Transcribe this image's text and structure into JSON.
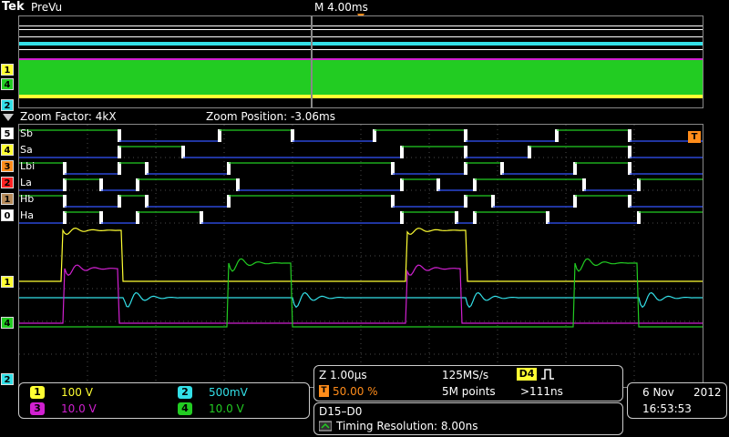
{
  "header": {
    "brand": "Tek",
    "mode": "PreVu",
    "timebase": "M 4.00ms",
    "trigger_marker": "T"
  },
  "zoom": {
    "factor": "Zoom Factor: 4kX",
    "position": "Zoom Position: -3.06ms"
  },
  "digital_channels": [
    {
      "num": "5",
      "label": "Sb",
      "color": "#ffffff"
    },
    {
      "num": "4",
      "label": "Sa",
      "color": "#ffff33"
    },
    {
      "num": "3",
      "label": "Lbi",
      "color": "#ff8c1a"
    },
    {
      "num": "2",
      "label": "La",
      "color": "#ff2222"
    },
    {
      "num": "1",
      "label": "Hb",
      "color": "#b58a5a"
    },
    {
      "num": "0",
      "label": "Ha",
      "color": "#ffffff"
    }
  ],
  "overview_markers": [
    "1",
    "4",
    "2"
  ],
  "main_markers": {
    "ch1": "1",
    "ch4": "4",
    "ch2": "2"
  },
  "channels": [
    {
      "num": "1",
      "scale": "100 V",
      "color": "#ffff33"
    },
    {
      "num": "2",
      "scale": "500mV",
      "color": "#33e0e8"
    },
    {
      "num": "3",
      "scale": "10.0 V",
      "color": "#d020d0"
    },
    {
      "num": "4",
      "scale": "10.0 V",
      "color": "#22cc22"
    }
  ],
  "acquisition": {
    "horizontal": "Z 1.00µs",
    "sample_rate": "125MS/s",
    "trigger_pos": "50.00 %",
    "record": "5M points",
    "trigger_source": "D4",
    "trigger_level": ">111ns"
  },
  "bus": {
    "name": "D15–D0",
    "resolution": "Timing Resolution: 8.00ns"
  },
  "datetime": {
    "date": "6 Nov",
    "year": "2012",
    "time": "16:53:53"
  },
  "colors": {
    "grid": "#4a4a4a",
    "ch1": "#ffff33",
    "ch2": "#33e0e8",
    "ch3": "#d020d0",
    "ch4": "#22cc22",
    "digital_high": "#22cc22",
    "digital_low": "#3355ff"
  }
}
